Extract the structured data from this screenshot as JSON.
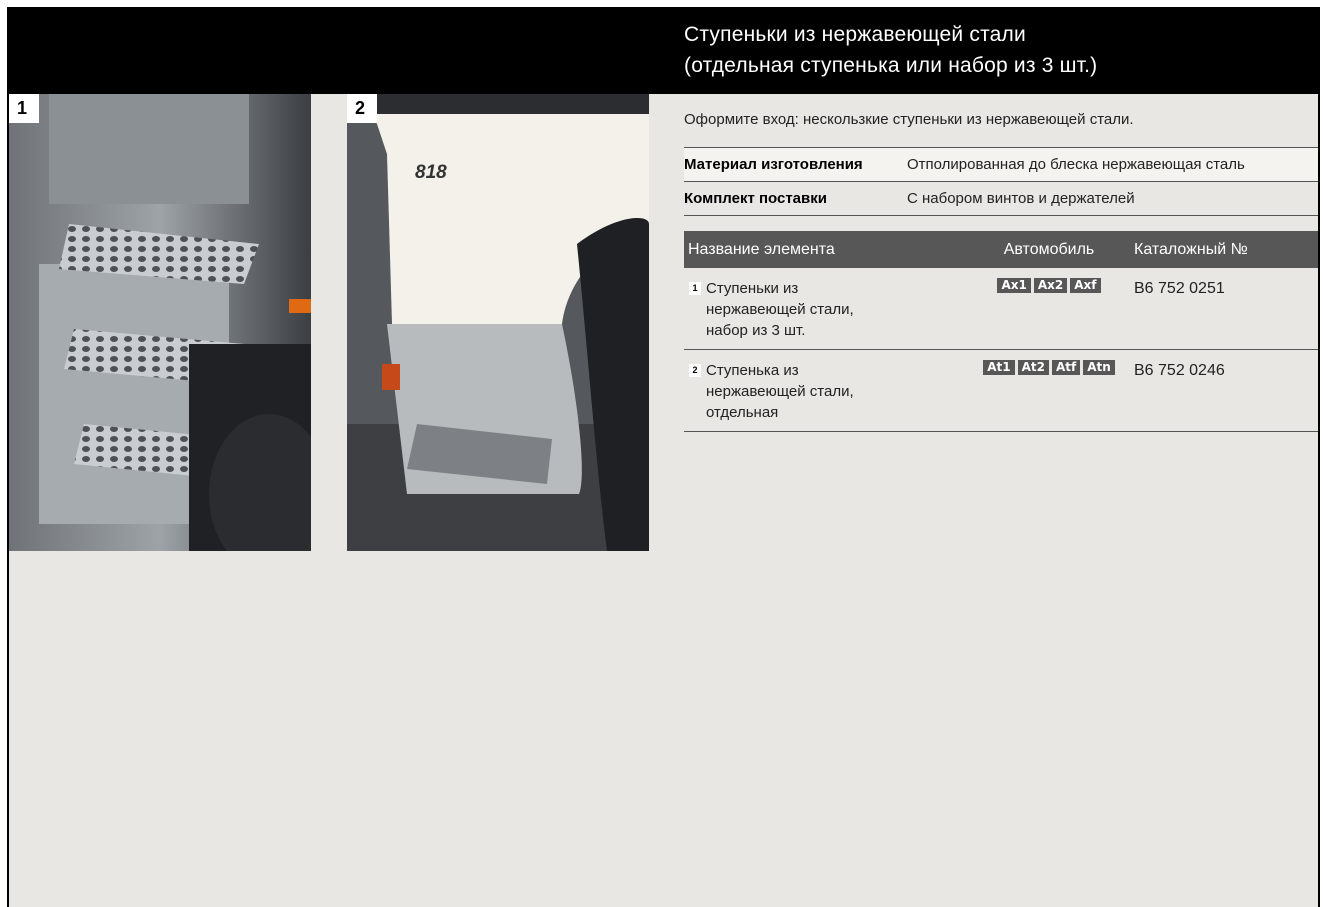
{
  "title": {
    "line1": "Ступеньки из нержавеющей стали",
    "line2": "(отдельная ступенька или набор из 3 шт.)"
  },
  "photos": [
    {
      "number": "1",
      "description": "stainless steel steps set of 3"
    },
    {
      "number": "2",
      "description": "single stainless steel step"
    }
  ],
  "intro": "Оформите вход: нескользкие ступеньки из нержавеющей стали.",
  "properties": [
    {
      "key": "Материал изготовления",
      "value": "Отполированная до блеска нержавеющая сталь"
    },
    {
      "key": "Комплект поставки",
      "value": "С набором винтов и держателей"
    }
  ],
  "table": {
    "headers": {
      "name": "Название элемента",
      "vehicle": "Автомобиль",
      "catalog": "Каталожный №"
    },
    "rows": [
      {
        "num": "1",
        "name_lines": [
          "Ступеньки из",
          "нержавеющей стали,",
          "набор из 3 шт."
        ],
        "vehicles": [
          "Ax1",
          "Ax2",
          "Axf"
        ],
        "catalog": "B6 752 0251"
      },
      {
        "num": "2",
        "name_lines": [
          "Ступенька из",
          "нержавеющей стали,",
          "отдельная"
        ],
        "vehicles": [
          "At1",
          "At2",
          "Atf",
          "Atn"
        ],
        "catalog": "B6 752 0246"
      }
    ]
  },
  "photo2_badge": "818",
  "colors": {
    "header_bg": "#000000",
    "page_bg": "#e8e7e3",
    "table_head_bg": "#575757"
  }
}
